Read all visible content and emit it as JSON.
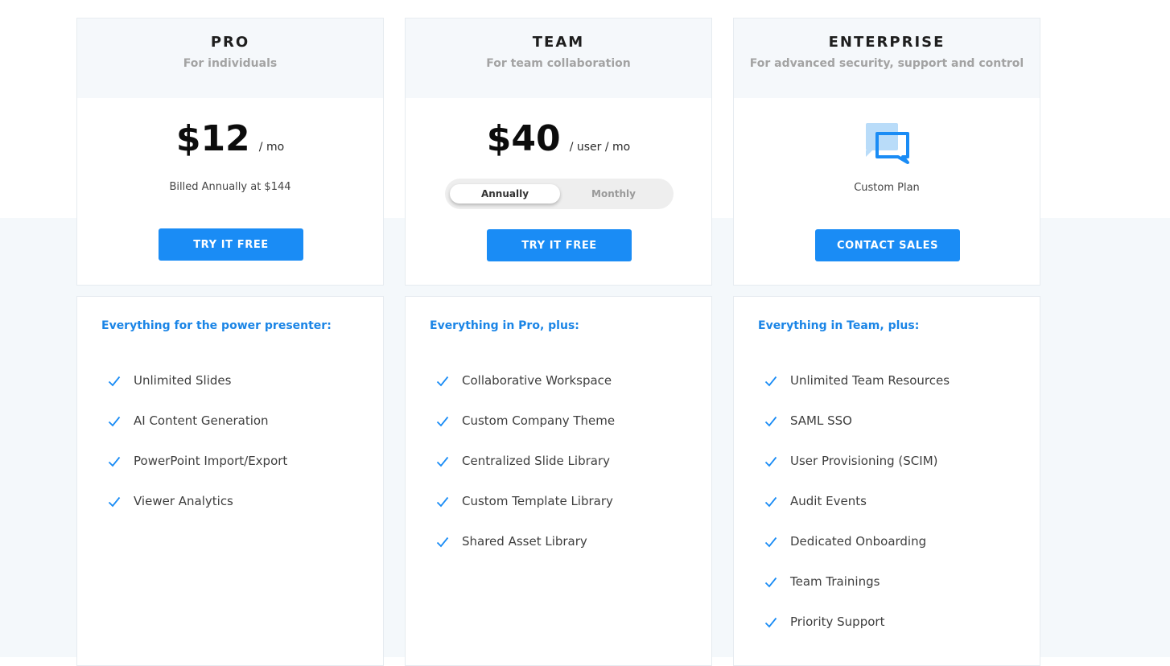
{
  "colors": {
    "accent": "#1a8cf5",
    "feature_title": "#1b85e6",
    "header_bg": "#f5f8fb",
    "page_bg_lower": "#f4f8fb"
  },
  "plans": [
    {
      "name": "PRO",
      "subtitle": "For individuals",
      "price": "$12",
      "period": "/ mo",
      "billing_note": "Billed Annually at $144",
      "cta": "TRY IT FREE",
      "features_title": "Everything for the power presenter:",
      "features": [
        "Unlimited Slides",
        "AI Content Generation",
        "PowerPoint Import/Export",
        "Viewer Analytics"
      ]
    },
    {
      "name": "TEAM",
      "subtitle": "For team collaboration",
      "price": "$40",
      "period": "/ user / mo",
      "billing_toggle": {
        "options": [
          "Annually",
          "Monthly"
        ],
        "selected": "Annually"
      },
      "cta": "TRY IT FREE",
      "features_title": "Everything in Pro, plus:",
      "features": [
        "Collaborative Workspace",
        "Custom Company Theme",
        "Centralized Slide Library",
        "Custom Template Library",
        "Shared Asset Library"
      ]
    },
    {
      "name": "ENTERPRISE",
      "subtitle": "For advanced security, support and control",
      "icon": "chat-bubble-icon",
      "custom_label": "Custom Plan",
      "cta": "CONTACT SALES",
      "features_title": "Everything in Team, plus:",
      "features": [
        "Unlimited Team Resources",
        "SAML SSO",
        "User Provisioning (SCIM)",
        "Audit Events",
        "Dedicated Onboarding",
        "Team Trainings",
        "Priority Support"
      ]
    }
  ]
}
